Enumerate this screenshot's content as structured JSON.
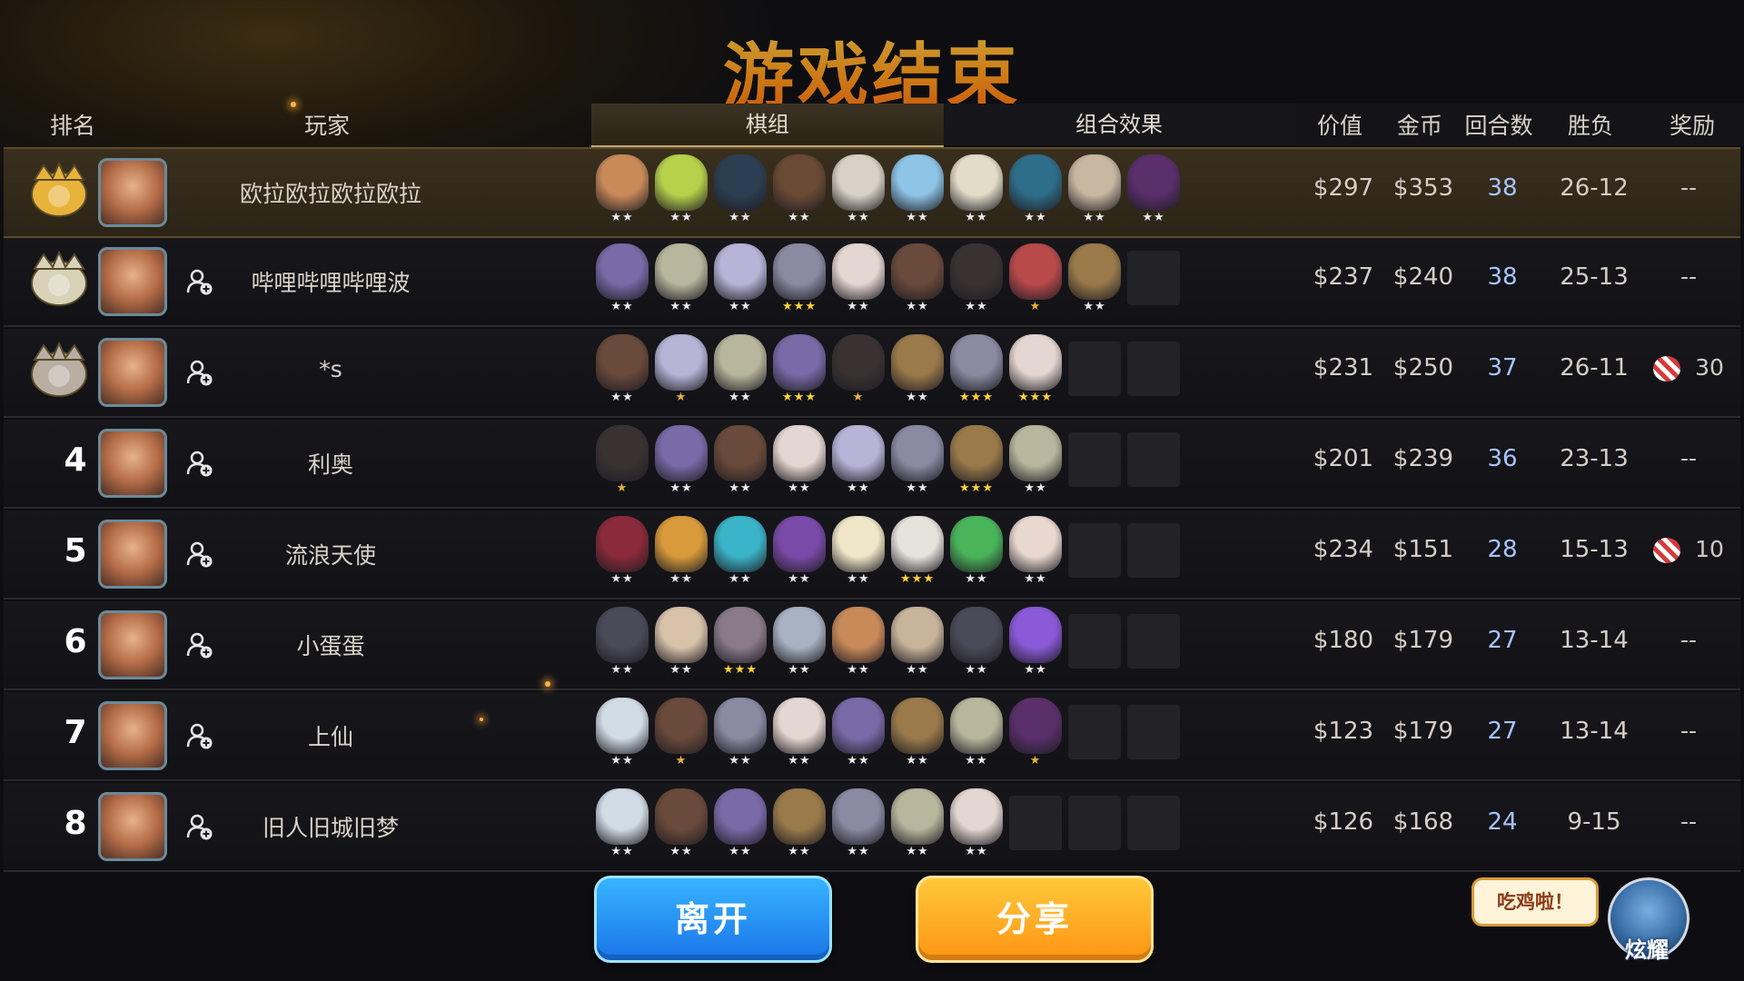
{
  "title": "游戏结束",
  "headers": {
    "rank": "排名",
    "player": "玩家",
    "lineup_tab": "棋组",
    "synergy_tab": "组合效果",
    "value": "价值",
    "gold": "金币",
    "rounds": "回合数",
    "record": "胜负",
    "reward": "奖励"
  },
  "rows": [
    {
      "rank": "1",
      "badge": "gold-crown-badge",
      "name": "欧拉欧拉欧拉欧拉",
      "value": "$297",
      "gold": "$353",
      "rounds": "38",
      "record": "26-12",
      "reward": "--",
      "reward_icon": false,
      "add_friend": false,
      "units": [
        {
          "stars": "★★",
          "color": "#c98a5a"
        },
        {
          "stars": "★★",
          "color": "#b7d24a"
        },
        {
          "stars": "★★",
          "color": "#2c3f52"
        },
        {
          "stars": "★★",
          "color": "#6a4a34"
        },
        {
          "stars": "★★",
          "color": "#d8d2c6"
        },
        {
          "stars": "★★",
          "color": "#8ec4e6"
        },
        {
          "stars": "★★",
          "color": "#e2dcc8"
        },
        {
          "stars": "★★",
          "color": "#2f6e8a"
        },
        {
          "stars": "★★",
          "color": "#c8b8a2"
        },
        {
          "stars": "★★",
          "color": "#5a2f6a"
        }
      ],
      "empty": 0
    },
    {
      "rank": "2",
      "badge": "silver-crown-badge",
      "name": "哔哩哔哩哔哩波",
      "value": "$237",
      "gold": "$240",
      "rounds": "38",
      "record": "25-13",
      "reward": "--",
      "reward_icon": false,
      "add_friend": true,
      "units": [
        {
          "stars": "★★",
          "color": "#7a6aa8"
        },
        {
          "stars": "★★",
          "color": "#b8b69c"
        },
        {
          "stars": "★★",
          "color": "#b8b4d8"
        },
        {
          "stars": "★★★",
          "color": "#8a8aa2"
        },
        {
          "stars": "★★",
          "color": "#e4d6d0"
        },
        {
          "stars": "★★",
          "color": "#6a4a3a"
        },
        {
          "stars": "★★",
          "color": "#3a3232"
        },
        {
          "stars": "★",
          "color": "#b84a4a"
        },
        {
          "stars": "★★",
          "color": "#9a7a4a"
        }
      ],
      "empty": 1
    },
    {
      "rank": "3",
      "badge": "bronze-crown-badge",
      "name": "*s",
      "value": "$231",
      "gold": "$250",
      "rounds": "37",
      "record": "26-11",
      "reward": "30",
      "reward_icon": true,
      "add_friend": true,
      "units": [
        {
          "stars": "★★",
          "color": "#6a4a3a"
        },
        {
          "stars": "★",
          "color": "#b8b4d8"
        },
        {
          "stars": "★★",
          "color": "#b8b69c"
        },
        {
          "stars": "★★★",
          "color": "#7a6aa8"
        },
        {
          "stars": "★",
          "color": "#3a3232"
        },
        {
          "stars": "★★",
          "color": "#9a7a4a"
        },
        {
          "stars": "★★★",
          "color": "#8a8aa2"
        },
        {
          "stars": "★★★",
          "color": "#e4d6d0"
        }
      ],
      "empty": 2
    },
    {
      "rank": "4",
      "badge": "",
      "name": "利奥",
      "value": "$201",
      "gold": "$239",
      "rounds": "36",
      "record": "23-13",
      "reward": "--",
      "reward_icon": false,
      "add_friend": true,
      "units": [
        {
          "stars": "★",
          "color": "#3a3232"
        },
        {
          "stars": "★★",
          "color": "#7a6aa8"
        },
        {
          "stars": "★★",
          "color": "#6a4a3a"
        },
        {
          "stars": "★★",
          "color": "#e4d6d0"
        },
        {
          "stars": "★★",
          "color": "#b8b4d8"
        },
        {
          "stars": "★★",
          "color": "#8a8aa2"
        },
        {
          "stars": "★★★",
          "color": "#9a7a4a"
        },
        {
          "stars": "★★",
          "color": "#b8b69c"
        }
      ],
      "empty": 2
    },
    {
      "rank": "5",
      "badge": "",
      "name": "流浪天使",
      "value": "$234",
      "gold": "$151",
      "rounds": "28",
      "record": "15-13",
      "reward": "10",
      "reward_icon": true,
      "add_friend": true,
      "units": [
        {
          "stars": "★★",
          "color": "#8a2a3a"
        },
        {
          "stars": "★★",
          "color": "#d89a3a"
        },
        {
          "stars": "★★",
          "color": "#3ab4c8"
        },
        {
          "stars": "★★",
          "color": "#7a4aa8"
        },
        {
          "stars": "★★",
          "color": "#f0e6c8"
        },
        {
          "stars": "★★★",
          "color": "#e6e2dc"
        },
        {
          "stars": "★★",
          "color": "#4ab45a"
        },
        {
          "stars": "★★",
          "color": "#e8d8d0"
        }
      ],
      "empty": 2
    },
    {
      "rank": "6",
      "badge": "",
      "name": "小蛋蛋",
      "value": "$180",
      "gold": "$179",
      "rounds": "27",
      "record": "13-14",
      "reward": "--",
      "reward_icon": false,
      "add_friend": true,
      "units": [
        {
          "stars": "★★",
          "color": "#4a4a58"
        },
        {
          "stars": "★★",
          "color": "#d8c2aa"
        },
        {
          "stars": "★★★",
          "color": "#8a7a8a"
        },
        {
          "stars": "★★",
          "color": "#a8b2c2"
        },
        {
          "stars": "★★",
          "color": "#c98a5a"
        },
        {
          "stars": "★★",
          "color": "#c8b49a"
        },
        {
          "stars": "★★",
          "color": "#4a4a58"
        },
        {
          "stars": "★★",
          "color": "#8a5ad8"
        }
      ],
      "empty": 2
    },
    {
      "rank": "7",
      "badge": "",
      "name": "上仙",
      "value": "$123",
      "gold": "$179",
      "rounds": "27",
      "record": "13-14",
      "reward": "--",
      "reward_icon": false,
      "add_friend": true,
      "units": [
        {
          "stars": "★★",
          "color": "#d2dce6"
        },
        {
          "stars": "★",
          "color": "#6a4a3a"
        },
        {
          "stars": "★★",
          "color": "#8a8aa2"
        },
        {
          "stars": "★★",
          "color": "#e4d6d0"
        },
        {
          "stars": "★★",
          "color": "#7a6aa8"
        },
        {
          "stars": "★★",
          "color": "#9a7a4a"
        },
        {
          "stars": "★★",
          "color": "#b8b69c"
        },
        {
          "stars": "★",
          "color": "#5a2f6a"
        }
      ],
      "empty": 2
    },
    {
      "rank": "8",
      "badge": "",
      "name": "旧人旧城旧梦",
      "value": "$126",
      "gold": "$168",
      "rounds": "24",
      "record": "9-15",
      "reward": "--",
      "reward_icon": false,
      "add_friend": true,
      "units": [
        {
          "stars": "★★",
          "color": "#d2dce6"
        },
        {
          "stars": "★★",
          "color": "#6a4a3a"
        },
        {
          "stars": "★★",
          "color": "#7a6aa8"
        },
        {
          "stars": "★★",
          "color": "#9a7a4a"
        },
        {
          "stars": "★★",
          "color": "#8a8aa2"
        },
        {
          "stars": "★★",
          "color": "#b8b69c"
        },
        {
          "stars": "★★",
          "color": "#e4d6d0"
        }
      ],
      "empty": 3
    }
  ],
  "buttons": {
    "leave": "离开",
    "share": "分享"
  },
  "bubble": "吃鸡啦！",
  "mascot_label": "炫耀",
  "colors": {
    "title": "#ff9c1e",
    "rounds": "#a7c4ff",
    "leave": "#1a74e8",
    "share": "#ff9514"
  }
}
